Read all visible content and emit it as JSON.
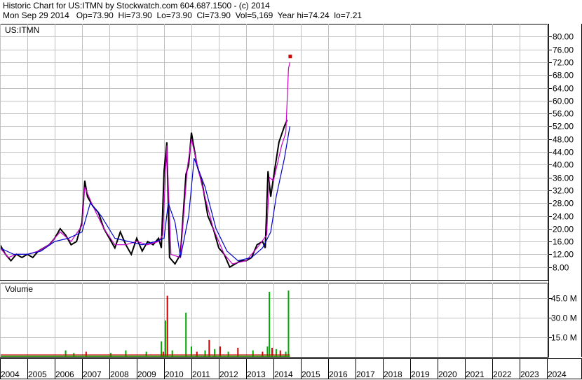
{
  "header": {
    "line1": "Historic Chart for US:ITMN by Stockwatch.com 604.687.1500 - (c) 2014",
    "line2": "Mon Sep 29 2014   Op=73.90  Hi=73.90  Lo=73.90  Cl=73.90  Vol=5,169  Year hi=74.24  lo=7.21"
  },
  "chart_data": [
    {
      "type": "line",
      "title": "US:ITMN",
      "ylim": [
        4,
        84
      ],
      "y_ticks": [
        8,
        12,
        16,
        20,
        24,
        28,
        32,
        36,
        40,
        44,
        48,
        52,
        56,
        60,
        64,
        68,
        72,
        76,
        80
      ],
      "y_tick_labels": [
        "8.00",
        "12.00",
        "16.00",
        "20.00",
        "24.00",
        "28.00",
        "32.00",
        "36.00",
        "40.00",
        "44.00",
        "48.00",
        "52.00",
        "56.00",
        "60.00",
        "64.00",
        "68.00",
        "72.00",
        "76.00",
        "80.00"
      ],
      "grid": true,
      "x_tick_labels": [
        "2004",
        "2005",
        "2006",
        "2007",
        "2008",
        "2009",
        "2010",
        "2011",
        "2012",
        "2013",
        "2014",
        "2015",
        "2016",
        "2017",
        "2018",
        "2019",
        "2020",
        "2021",
        "2022",
        "2023",
        "2024"
      ],
      "series": [
        {
          "color": "#000000",
          "points": [
            [
              2004.0,
              15
            ],
            [
              2004.2,
              12
            ],
            [
              2004.4,
              10
            ],
            [
              2004.6,
              12
            ],
            [
              2004.8,
              11
            ],
            [
              2005.0,
              12
            ],
            [
              2005.2,
              11
            ],
            [
              2005.4,
              13
            ],
            [
              2005.6,
              14
            ],
            [
              2005.8,
              15
            ],
            [
              2006.0,
              17
            ],
            [
              2006.2,
              20
            ],
            [
              2006.4,
              18
            ],
            [
              2006.6,
              15
            ],
            [
              2006.8,
              16
            ],
            [
              2007.0,
              22
            ],
            [
              2007.1,
              35
            ],
            [
              2007.2,
              30
            ],
            [
              2007.4,
              27
            ],
            [
              2007.6,
              25
            ],
            [
              2007.8,
              20
            ],
            [
              2008.0,
              17
            ],
            [
              2008.2,
              14
            ],
            [
              2008.4,
              19
            ],
            [
              2008.6,
              15
            ],
            [
              2008.8,
              12
            ],
            [
              2009.0,
              17
            ],
            [
              2009.2,
              13
            ],
            [
              2009.4,
              16
            ],
            [
              2009.6,
              15
            ],
            [
              2009.8,
              17
            ],
            [
              2009.9,
              14
            ],
            [
              2010.0,
              38
            ],
            [
              2010.1,
              47
            ],
            [
              2010.2,
              11
            ],
            [
              2010.4,
              9
            ],
            [
              2010.6,
              12
            ],
            [
              2010.8,
              37
            ],
            [
              2010.9,
              40
            ],
            [
              2011.0,
              50
            ],
            [
              2011.2,
              40
            ],
            [
              2011.4,
              34
            ],
            [
              2011.6,
              24
            ],
            [
              2011.8,
              20
            ],
            [
              2012.0,
              14
            ],
            [
              2012.2,
              12
            ],
            [
              2012.4,
              8
            ],
            [
              2012.6,
              9
            ],
            [
              2012.8,
              10
            ],
            [
              2013.0,
              10
            ],
            [
              2013.2,
              11
            ],
            [
              2013.4,
              15
            ],
            [
              2013.6,
              16
            ],
            [
              2013.7,
              14
            ],
            [
              2013.8,
              38
            ],
            [
              2013.9,
              30
            ],
            [
              2014.0,
              36
            ],
            [
              2014.2,
              47
            ],
            [
              2014.4,
              52
            ],
            [
              2014.5,
              54
            ]
          ]
        },
        {
          "color": "#cc00cc",
          "points": [
            [
              2004.0,
              14
            ],
            [
              2004.3,
              11
            ],
            [
              2004.6,
              12
            ],
            [
              2005.0,
              12
            ],
            [
              2005.4,
              13
            ],
            [
              2005.8,
              15
            ],
            [
              2006.2,
              19
            ],
            [
              2006.6,
              16
            ],
            [
              2007.0,
              21
            ],
            [
              2007.1,
              33
            ],
            [
              2007.4,
              27
            ],
            [
              2007.8,
              20
            ],
            [
              2008.2,
              15
            ],
            [
              2008.6,
              15
            ],
            [
              2009.0,
              16
            ],
            [
              2009.4,
              15
            ],
            [
              2009.8,
              16
            ],
            [
              2009.95,
              18
            ],
            [
              2010.1,
              46
            ],
            [
              2010.25,
              12
            ],
            [
              2010.6,
              11
            ],
            [
              2010.85,
              39
            ],
            [
              2011.0,
              48
            ],
            [
              2011.4,
              33
            ],
            [
              2011.8,
              20
            ],
            [
              2012.2,
              12
            ],
            [
              2012.5,
              9
            ],
            [
              2013.0,
              10
            ],
            [
              2013.4,
              14
            ],
            [
              2013.75,
              18
            ],
            [
              2013.85,
              36
            ],
            [
              2014.0,
              35
            ],
            [
              2014.3,
              46
            ],
            [
              2014.45,
              50
            ],
            [
              2014.55,
              70
            ],
            [
              2014.6,
              72
            ]
          ]
        },
        {
          "color": "#0000cc",
          "points": [
            [
              2004.0,
              14
            ],
            [
              2004.5,
              12
            ],
            [
              2005.0,
              12
            ],
            [
              2005.5,
              13
            ],
            [
              2006.0,
              16
            ],
            [
              2006.5,
              17
            ],
            [
              2007.0,
              19
            ],
            [
              2007.3,
              28
            ],
            [
              2007.7,
              24
            ],
            [
              2008.2,
              17
            ],
            [
              2008.7,
              16
            ],
            [
              2009.2,
              15
            ],
            [
              2009.7,
              16
            ],
            [
              2010.0,
              17
            ],
            [
              2010.15,
              28
            ],
            [
              2010.4,
              22
            ],
            [
              2010.6,
              11
            ],
            [
              2010.9,
              24
            ],
            [
              2011.1,
              42
            ],
            [
              2011.5,
              33
            ],
            [
              2011.9,
              20
            ],
            [
              2012.3,
              13
            ],
            [
              2012.7,
              10
            ],
            [
              2013.2,
              11
            ],
            [
              2013.6,
              14
            ],
            [
              2013.9,
              19
            ],
            [
              2014.1,
              30
            ],
            [
              2014.4,
              42
            ],
            [
              2014.6,
              52
            ]
          ]
        }
      ],
      "markers": [
        {
          "x": 2014.6,
          "y": 73.9,
          "color": "#cc0000"
        }
      ]
    },
    {
      "type": "bar",
      "title": "Volume",
      "ylim": [
        0,
        57
      ],
      "y_ticks": [
        15,
        30,
        45
      ],
      "y_tick_labels": [
        "15.0 M",
        "30.0 M",
        "45.0 M"
      ],
      "grid": true,
      "bars": [
        {
          "x": 2006.4,
          "v": 5,
          "color": "#00aa00"
        },
        {
          "x": 2006.7,
          "v": 3,
          "color": "#00aa00"
        },
        {
          "x": 2007.15,
          "v": 4,
          "color": "#cc0000"
        },
        {
          "x": 2008.05,
          "v": 3,
          "color": "#00aa00"
        },
        {
          "x": 2008.6,
          "v": 5,
          "color": "#00aa00"
        },
        {
          "x": 2009.35,
          "v": 4,
          "color": "#00aa00"
        },
        {
          "x": 2009.9,
          "v": 12,
          "color": "#00aa00"
        },
        {
          "x": 2009.97,
          "v": 4,
          "color": "#cc0000"
        },
        {
          "x": 2010.05,
          "v": 28,
          "color": "#00aa00"
        },
        {
          "x": 2010.12,
          "v": 47,
          "color": "#cc0000"
        },
        {
          "x": 2010.3,
          "v": 5,
          "color": "#00aa00"
        },
        {
          "x": 2010.8,
          "v": 34,
          "color": "#00aa00"
        },
        {
          "x": 2011.0,
          "v": 8,
          "color": "#00aa00"
        },
        {
          "x": 2011.2,
          "v": 4,
          "color": "#cc0000"
        },
        {
          "x": 2011.5,
          "v": 5,
          "color": "#00aa00"
        },
        {
          "x": 2011.65,
          "v": 13,
          "color": "#cc0000"
        },
        {
          "x": 2011.85,
          "v": 6,
          "color": "#00aa00"
        },
        {
          "x": 2012.05,
          "v": 8,
          "color": "#cc0000"
        },
        {
          "x": 2012.35,
          "v": 4,
          "color": "#00aa00"
        },
        {
          "x": 2012.7,
          "v": 7,
          "color": "#cc0000"
        },
        {
          "x": 2013.25,
          "v": 5,
          "color": "#00aa00"
        },
        {
          "x": 2013.6,
          "v": 4,
          "color": "#cc0000"
        },
        {
          "x": 2013.78,
          "v": 8,
          "color": "#00aa00"
        },
        {
          "x": 2013.85,
          "v": 50,
          "color": "#00aa00"
        },
        {
          "x": 2013.95,
          "v": 7,
          "color": "#cc0000"
        },
        {
          "x": 2014.1,
          "v": 6,
          "color": "#00aa00"
        },
        {
          "x": 2014.25,
          "v": 5,
          "color": "#cc0000"
        },
        {
          "x": 2014.45,
          "v": 4,
          "color": "#00aa00"
        },
        {
          "x": 2014.55,
          "v": 51,
          "color": "#00aa00"
        }
      ]
    }
  ]
}
